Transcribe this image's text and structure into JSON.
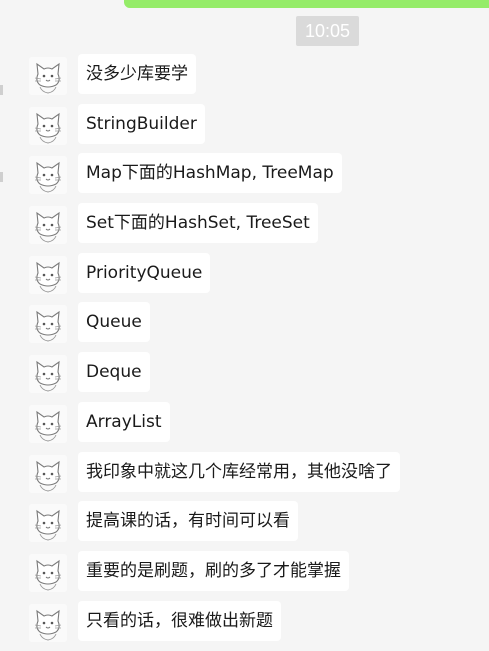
{
  "chat": {
    "timestamp": "10:05",
    "messages": [
      {
        "text": "没多少库要学"
      },
      {
        "text": "StringBuilder"
      },
      {
        "text": "Map下面的HashMap, TreeMap"
      },
      {
        "text": "Set下面的HashSet, TreeSet"
      },
      {
        "text": "PriorityQueue"
      },
      {
        "text": "Queue"
      },
      {
        "text": "Deque"
      },
      {
        "text": "ArrayList"
      },
      {
        "text": "我印象中就这几个库经常用，其他没啥了"
      },
      {
        "text": "提高课的话，有时间可以看"
      },
      {
        "text": "重要的是刷题，刷的多了才能掌握"
      },
      {
        "text": "只看的话，很难做出新题"
      }
    ]
  },
  "colors": {
    "background": "#f5f5f5",
    "own_bubble": "#95ec69",
    "other_bubble": "#ffffff",
    "timestamp_bg": "#dadada"
  },
  "icons": {
    "avatar": "cat-sketch-avatar-icon"
  }
}
